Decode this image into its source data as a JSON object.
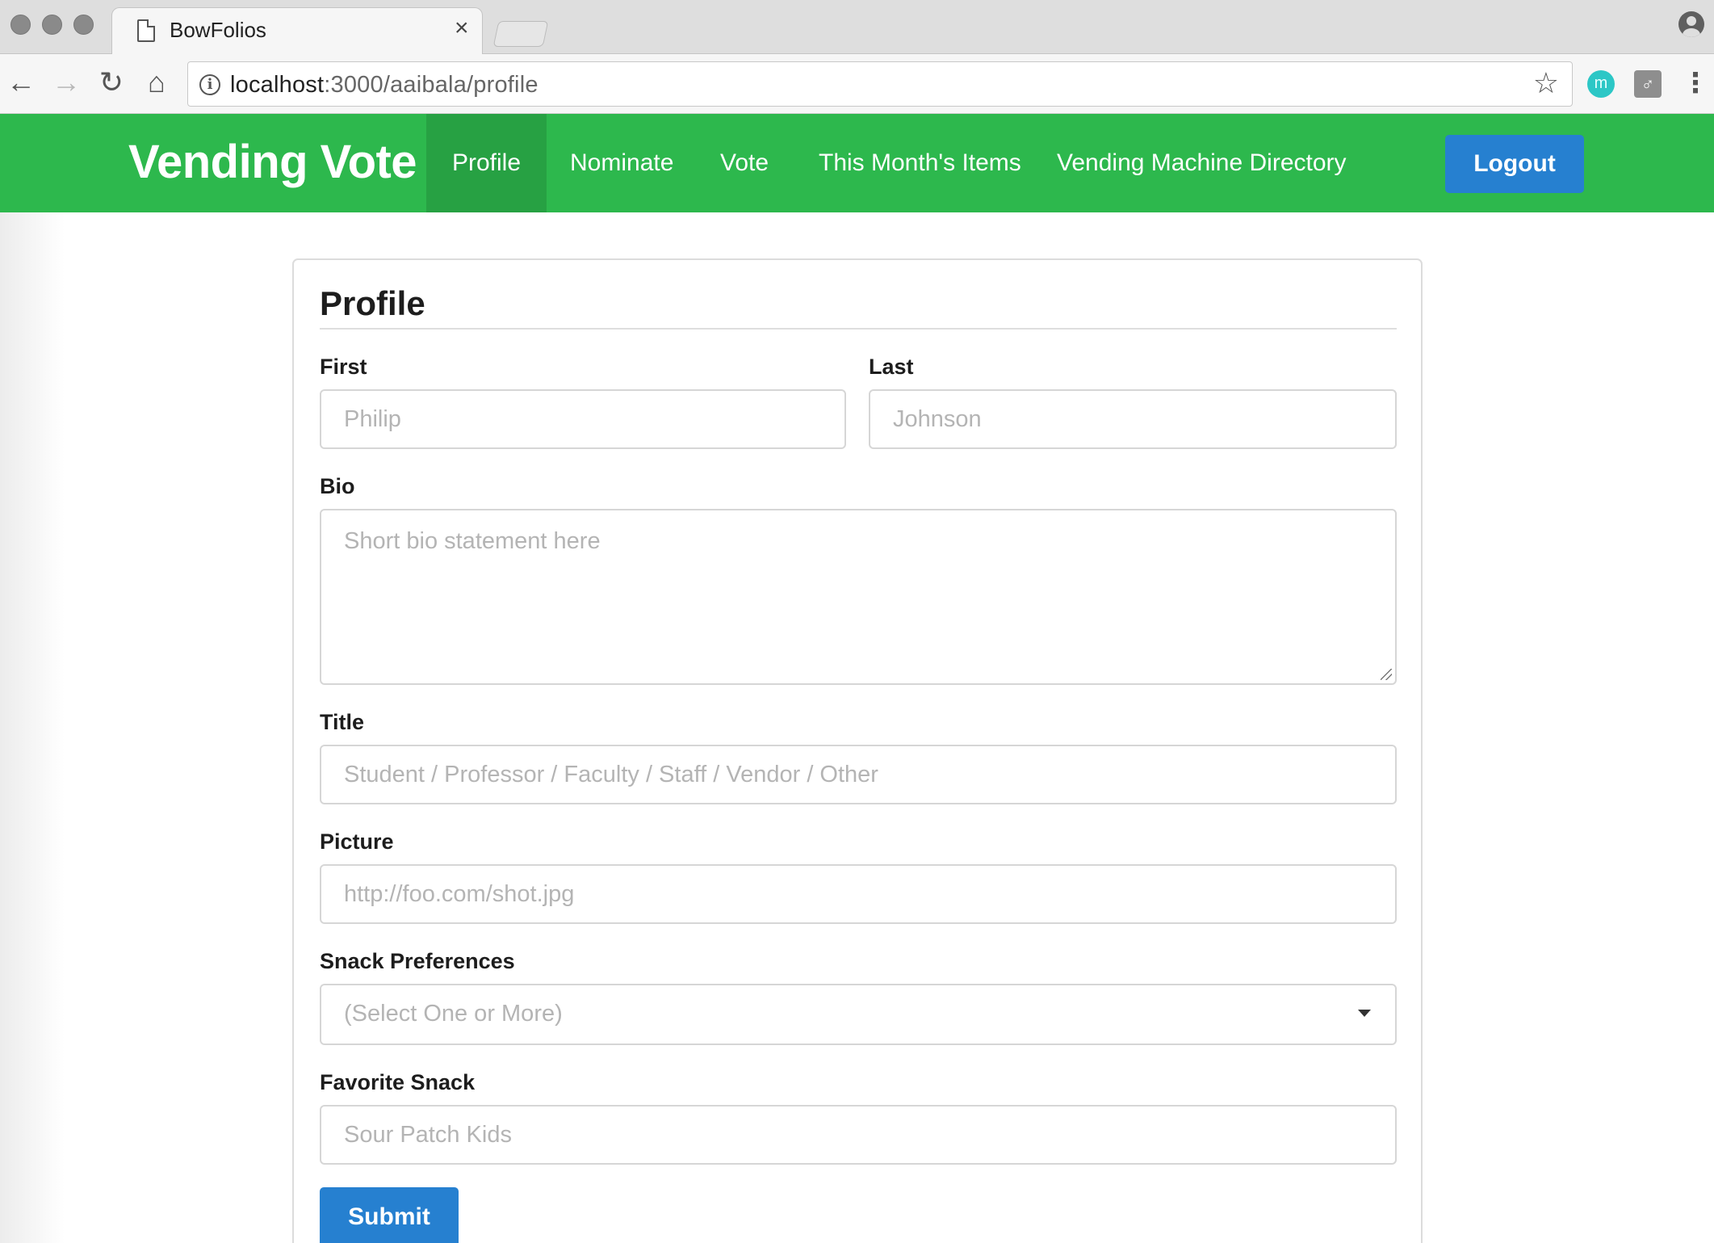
{
  "browser": {
    "tab_title": "BowFolios",
    "tab_close": "×",
    "url_host": "localhost",
    "url_rest": ":3000/aaibala/profile",
    "info_icon": "i",
    "back_icon": "←",
    "forward_icon": "→",
    "reload_icon": "↻",
    "home_icon": "⌂",
    "star_icon": "☆",
    "ext_m_label": "m",
    "ext_2_label": "♂",
    "menu_icon": "⋮"
  },
  "navbar": {
    "brand": "Vending Vote",
    "items": [
      {
        "label": "Profile",
        "active": true
      },
      {
        "label": "Nominate",
        "active": false
      },
      {
        "label": "Vote",
        "active": false
      },
      {
        "label": "This Month's Items",
        "active": false
      },
      {
        "label": "Vending Machine Directory",
        "active": false
      }
    ],
    "logout_label": "Logout",
    "bg_color": "#2db84d",
    "active_color": "#27a143",
    "button_color": "#2680d0"
  },
  "form": {
    "title": "Profile",
    "first_label": "First",
    "first_placeholder": "Philip",
    "last_label": "Last",
    "last_placeholder": "Johnson",
    "bio_label": "Bio",
    "bio_placeholder": "Short bio statement here",
    "title_label": "Title",
    "title_placeholder": "Student / Professor / Faculty / Staff / Vendor / Other",
    "picture_label": "Picture",
    "picture_placeholder": "http://foo.com/shot.jpg",
    "snack_pref_label": "Snack Preferences",
    "snack_pref_placeholder": "(Select One or More)",
    "favorite_label": "Favorite Snack",
    "favorite_placeholder": "Sour Patch Kids",
    "submit_label": "Submit"
  }
}
